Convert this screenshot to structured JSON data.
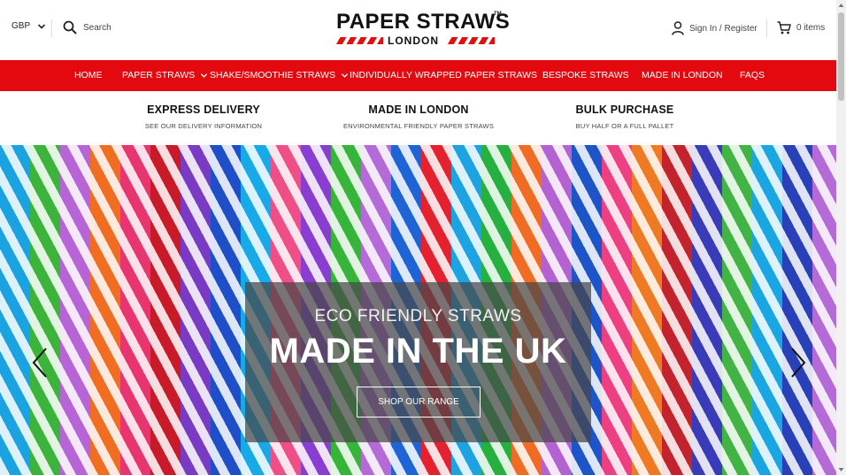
{
  "header": {
    "currency": "GBP",
    "search_label": "Search",
    "logo": {
      "main": "PAPER STRAWS",
      "sub": "LONDON",
      "tm": "TM"
    },
    "account_label": "Sign In / Register",
    "cart_label": "0 items"
  },
  "nav": {
    "items": [
      {
        "label": "HOME"
      },
      {
        "label": "PAPER STRAWS",
        "dropdown": true
      },
      {
        "label": "SHAKE/SMOOTHIE STRAWS",
        "dropdown": true
      },
      {
        "label": "INDIVIDUALLY WRAPPED PAPER STRAWS"
      },
      {
        "label": "BESPOKE STRAWS"
      },
      {
        "label": "MADE IN LONDON"
      },
      {
        "label": "FAQS"
      }
    ],
    "background": "#e4090f"
  },
  "features": [
    {
      "title": "EXPRESS DELIVERY",
      "subtitle": "SEE OUR DELIVERY INFORMATION"
    },
    {
      "title": "MADE IN LONDON",
      "subtitle": "ENVIRONMENTAL FRIENDLY PAPER STRAWS"
    },
    {
      "title": "BULK PURCHASE",
      "subtitle": "BUY HALF OR A FULL PALLET"
    }
  ],
  "hero": {
    "kicker": "ECO FRIENDLY STRAWS",
    "headline": "MADE IN THE UK",
    "cta": "SHOP OUR RANGE"
  },
  "icons": {
    "currency_dropdown": "chevron-down-icon",
    "search": "search-icon",
    "account": "user-icon",
    "cart": "cart-icon",
    "prev": "chevron-left-icon",
    "next": "chevron-right-icon"
  }
}
